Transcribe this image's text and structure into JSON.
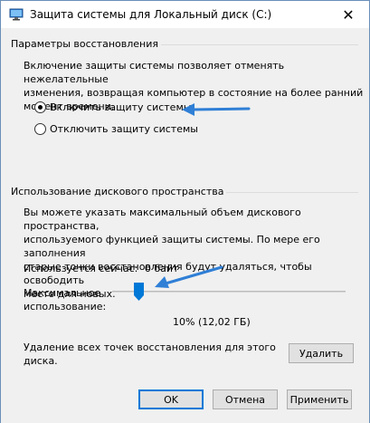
{
  "window": {
    "title": "Защита системы для Локальный диск (C:)",
    "close_glyph": "✕"
  },
  "restore_settings": {
    "header": "Параметры восстановления",
    "description_lines": [
      "Включение защиты системы позволяет отменять нежелательные",
      "изменения, возвращая компьютер в состояние на более ранний",
      "момент времени."
    ],
    "options": [
      {
        "label": "Включить защиту системы",
        "selected": true
      },
      {
        "label": "Отключить защиту системы",
        "selected": false
      }
    ]
  },
  "disk_usage": {
    "header": "Использование дискового пространства",
    "description_lines": [
      "Вы можете указать максимальный объем дискового пространства,",
      "используемого функцией защиты системы. По мере его заполнения",
      "старые точки восстановления будут удаляться, чтобы освободить",
      "место для новых."
    ],
    "current_usage_label": "Используется сейчас:",
    "current_usage_value": "0 байт",
    "max_usage_label_lines": [
      "Максимальное",
      "использование:"
    ],
    "max_usage_fraction": 0.1,
    "max_usage_value": "10% (12,02 ГБ)",
    "delete_text_lines": [
      "Удаление всех точек восстановления для этого",
      "диска."
    ],
    "delete_button": "Удалить"
  },
  "footer": {
    "ok": "OK",
    "cancel": "Отмена",
    "apply": "Применить"
  },
  "colors": {
    "annotation_arrow": "#2f7fd6",
    "accent": "#0078d7",
    "slider_thumb": "#0078d7"
  }
}
